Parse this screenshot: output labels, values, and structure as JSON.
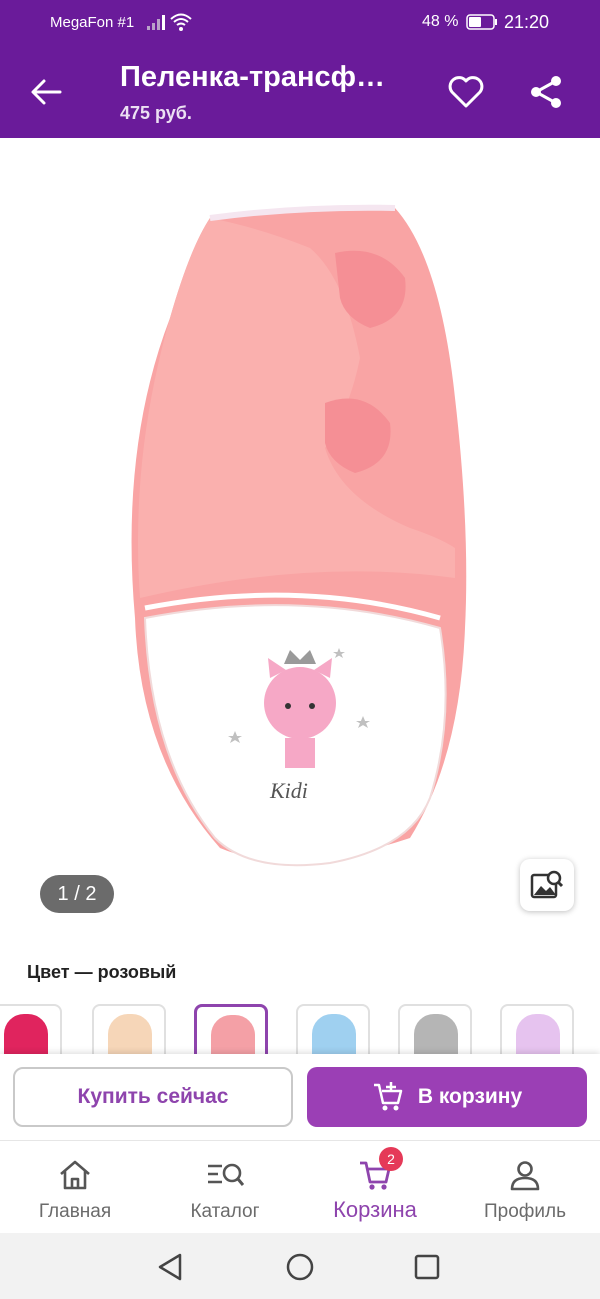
{
  "status_bar": {
    "carrier": "MegaFon #1",
    "battery_percent": "48 %",
    "time": "21:20"
  },
  "app_bar": {
    "title": "Пеленка-трансф…",
    "price": "475 руб."
  },
  "gallery": {
    "page_indicator": "1 / 2",
    "print_text": "Kidi"
  },
  "color": {
    "label": "Цвет — розовый",
    "swatches": [
      {
        "color": "#e0245e"
      },
      {
        "color": "#f6d6b8"
      },
      {
        "color": "#f4a0a6",
        "selected": true
      },
      {
        "color": "#9fd0f0"
      },
      {
        "color": "#b5b5b5"
      },
      {
        "color": "#e6c3ef"
      }
    ]
  },
  "actions": {
    "buy_now": "Купить сейчас",
    "add_to_cart": "В корзину"
  },
  "bottom_nav": {
    "items": [
      {
        "label": "Главная",
        "icon": "home-icon"
      },
      {
        "label": "Каталог",
        "icon": "catalog-search-icon"
      },
      {
        "label": "Корзина",
        "icon": "cart-icon",
        "badge": "2",
        "active": true
      },
      {
        "label": "Профиль",
        "icon": "profile-icon"
      }
    ]
  },
  "theme": {
    "primary": "#6a1b9a",
    "accent": "#9b3fb5",
    "badge": "#e53958"
  }
}
